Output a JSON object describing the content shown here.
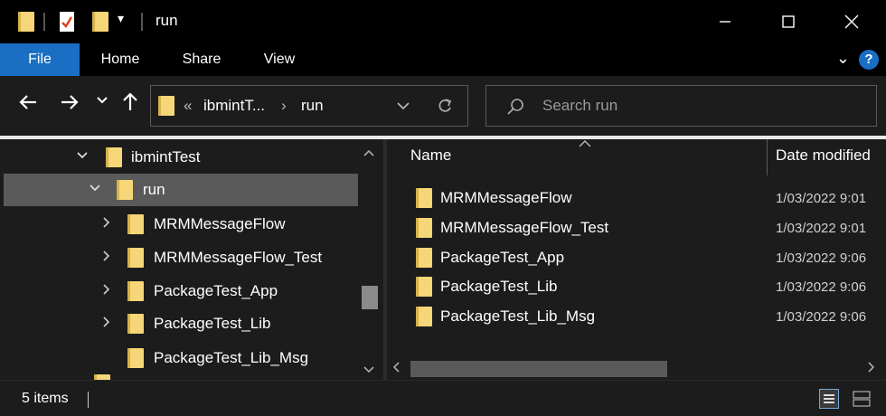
{
  "window": {
    "title": "run",
    "minimize_icon": "minimize-icon",
    "maximize_icon": "maximize-icon",
    "close_icon": "close-icon"
  },
  "ribbon": {
    "tabs": [
      "File",
      "Home",
      "Share",
      "View"
    ],
    "help_label": "?"
  },
  "address": {
    "overflow": "«",
    "crumbs": [
      "ibmintT...",
      "run"
    ],
    "separator": "›"
  },
  "search": {
    "placeholder": "Search run"
  },
  "tree": [
    {
      "label": "ibmintTest",
      "expanded": true,
      "selected": false
    },
    {
      "label": "run",
      "expanded": true,
      "selected": true
    },
    {
      "label": "MRMMessageFlow",
      "expanded": false,
      "selected": false
    },
    {
      "label": "MRMMessageFlow_Test",
      "expanded": false,
      "selected": false
    },
    {
      "label": "PackageTest_App",
      "expanded": false,
      "selected": false
    },
    {
      "label": "PackageTest_Lib",
      "expanded": false,
      "selected": false
    },
    {
      "label": "PackageTest_Lib_Msg",
      "expanded": false,
      "selected": false
    }
  ],
  "columns": {
    "name": "Name",
    "date": "Date modified"
  },
  "files": [
    {
      "name": "MRMMessageFlow",
      "date": "1/03/2022 9:01"
    },
    {
      "name": "MRMMessageFlow_Test",
      "date": "1/03/2022 9:01"
    },
    {
      "name": "PackageTest_App",
      "date": "1/03/2022 9:06"
    },
    {
      "name": "PackageTest_Lib",
      "date": "1/03/2022 9:06"
    },
    {
      "name": "PackageTest_Lib_Msg",
      "date": "1/03/2022 9:06"
    }
  ],
  "status": {
    "count": "5 items"
  },
  "colors": {
    "accent": "#1a6fc4",
    "folder": "#f5d678",
    "background": "#000000",
    "pane": "#1c1c1c"
  }
}
